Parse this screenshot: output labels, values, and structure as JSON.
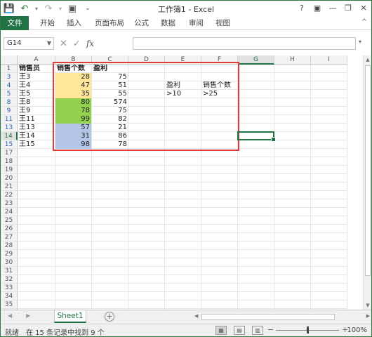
{
  "window": {
    "title": "工作簿1 - Excel",
    "help": "?",
    "ribbon_opts": "▣",
    "minimize": "—",
    "restore": "❐",
    "close": "✕"
  },
  "qat": {
    "save": "💾",
    "undo": "↶",
    "undo_dd": "▾",
    "redo": "↷",
    "redo_dd": "▾",
    "customize": "▣",
    "more": "⌄"
  },
  "ribbon": {
    "tabs": [
      "文件",
      "开始",
      "插入",
      "页面布局",
      "公式",
      "数据",
      "审阅",
      "视图"
    ],
    "collapse": "^"
  },
  "formula_bar": {
    "name_box": "G14",
    "name_dd": "▼",
    "cancel": "✕",
    "enter": "✓",
    "fx": "fx",
    "value": "",
    "expand": "▾"
  },
  "grid": {
    "columns": [
      "A",
      "B",
      "C",
      "D",
      "E",
      "F",
      "G",
      "H",
      "I"
    ],
    "selected_column": "G",
    "rows": [
      "1",
      "3",
      "4",
      "5",
      "8",
      "9",
      "11",
      "13",
      "14",
      "15",
      "17",
      "18",
      "19",
      "20",
      "21",
      "22",
      "23",
      "24",
      "25",
      "26",
      "27",
      "28",
      "29",
      "30",
      "31",
      "32",
      "33",
      "34",
      "35",
      "36"
    ],
    "filtered_row_color": "#2b5bbf",
    "selected_row": "14",
    "header": {
      "a": "销售员",
      "b": "销售个数",
      "c": "盈利"
    },
    "data": [
      {
        "a": "王3",
        "b": "28",
        "c": "75",
        "fill": "#ffe699"
      },
      {
        "a": "王4",
        "b": "47",
        "c": "51",
        "fill": "#ffe699"
      },
      {
        "a": "王5",
        "b": "35",
        "c": "55",
        "fill": "#ffe699"
      },
      {
        "a": "王8",
        "b": "80",
        "c": "574",
        "fill": "#92d050"
      },
      {
        "a": "王9",
        "b": "78",
        "c": "75",
        "fill": "#92d050"
      },
      {
        "a": "王11",
        "b": "99",
        "c": "82",
        "fill": "#92d050"
      },
      {
        "a": "王13",
        "b": "57",
        "c": "21",
        "fill": "#b4c6e7"
      },
      {
        "a": "王14",
        "b": "31",
        "c": "86",
        "fill": "#b4c6e7"
      },
      {
        "a": "王15",
        "b": "98",
        "c": "78",
        "fill": "#b4c6e7"
      }
    ],
    "criteria": {
      "e_header": "盈利",
      "f_header": "销售个数",
      "e_value": ">10",
      "f_value": ">25"
    },
    "highlight_color": "#e03c3c"
  },
  "sheets": {
    "tabs": [
      "Sheet1"
    ],
    "add": "+",
    "prev": "◀",
    "next": "▶"
  },
  "scroll": {
    "up": "▲",
    "down": "▼",
    "left": "◀",
    "right": "▶"
  },
  "status": {
    "ready": "就绪",
    "filter_msg": "在 15 条记录中找到 9 个",
    "views": [
      "▦",
      "▤",
      "▥"
    ],
    "zoom_minus": "−",
    "zoom_plus": "+",
    "zoom": "100%",
    "zoom_level": 0.5
  }
}
